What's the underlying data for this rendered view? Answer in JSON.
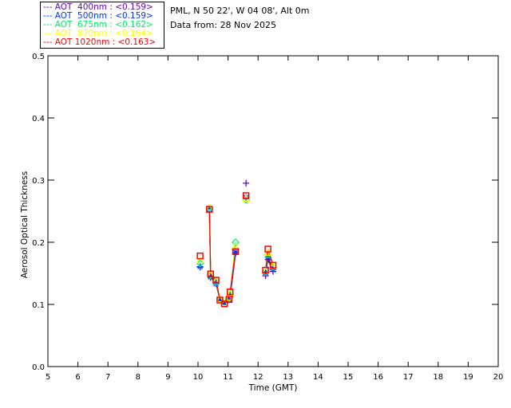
{
  "header": {
    "site": "PML, N 50 22', W 04 08', Alt 0m",
    "date": "Data from: 28 Nov 2025"
  },
  "chart_data": {
    "type": "scatter",
    "xlabel": "Time (GMT)",
    "ylabel": "Aerosol Optical Thickness",
    "xlim": [
      5,
      20
    ],
    "ylim": [
      0,
      0.5
    ],
    "xticks": [
      "5",
      "6",
      "7",
      "8",
      "9",
      "10",
      "11",
      "12",
      "13",
      "14",
      "15",
      "16",
      "17",
      "18",
      "19",
      "20"
    ],
    "yticks": [
      "0.0",
      "0.1",
      "0.2",
      "0.3",
      "0.4",
      "0.5"
    ],
    "grid": false,
    "legend_position": "top-left outside",
    "x": [
      10.07,
      10.38,
      10.42,
      10.6,
      10.73,
      10.88,
      11.03,
      11.07,
      11.25,
      11.6,
      12.25,
      12.33,
      12.5
    ],
    "series": [
      {
        "name": "AOT  400nm : <0.159>",
        "color": "#6600cc",
        "marker": "plus",
        "values": [
          0.16,
          0.253,
          0.143,
          0.135,
          0.107,
          0.101,
          0.107,
          0.112,
          0.182,
          0.295,
          0.146,
          0.172,
          0.153
        ]
      },
      {
        "name": "AOT  500nm : <0.159>",
        "color": "#0033ff",
        "marker": "asterisk",
        "values": [
          0.161,
          0.253,
          0.144,
          0.133,
          0.107,
          0.102,
          0.108,
          0.113,
          0.184,
          0.272,
          0.151,
          0.176,
          0.156
        ]
      },
      {
        "name": "AOT  675nm : <0.162>",
        "color": "#00ee66",
        "marker": "diamond",
        "values": [
          0.166,
          0.255,
          0.147,
          0.136,
          0.108,
          0.102,
          0.11,
          0.116,
          0.2,
          0.268,
          0.152,
          0.18,
          0.16
        ]
      },
      {
        "name": "AOT  870nm : <0.164>",
        "color": "#ffff00",
        "marker": "triangle",
        "values": [
          0.171,
          0.256,
          0.148,
          0.138,
          0.108,
          0.102,
          0.111,
          0.118,
          0.193,
          0.27,
          0.154,
          0.183,
          0.162
        ]
      },
      {
        "name": "AOT 1020nm : <0.163>",
        "color": "#ff0000",
        "marker": "square",
        "values": [
          0.178,
          0.253,
          0.149,
          0.139,
          0.107,
          0.101,
          0.108,
          0.12,
          0.185,
          0.275,
          0.155,
          0.189,
          0.163
        ]
      }
    ],
    "line_segments": [
      [
        1,
        8
      ],
      [
        10,
        12
      ]
    ]
  }
}
